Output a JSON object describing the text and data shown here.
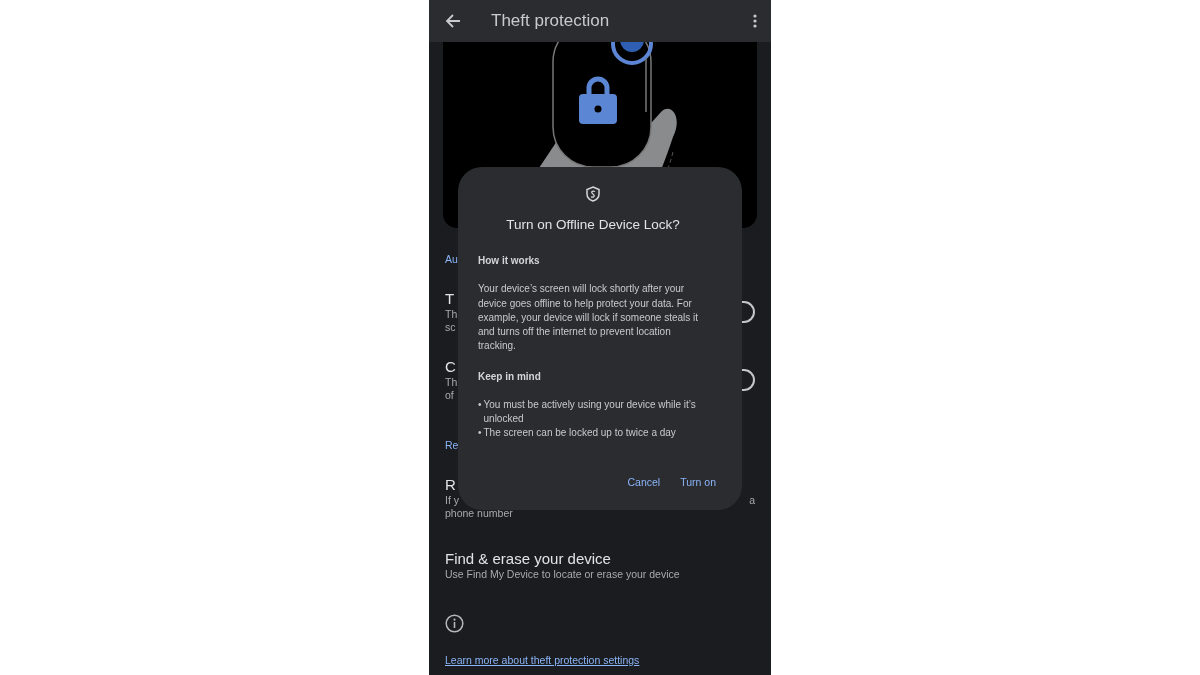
{
  "app_bar": {
    "title": "Theft protection"
  },
  "behind_dialog": {
    "section_link_1": "Au",
    "items": [
      {
        "title": "T",
        "subtitle_lines": [
          "Th",
          "sc"
        ],
        "toggle": {
          "on": false
        }
      },
      {
        "title": "C",
        "subtitle_lines": [
          "Th",
          "of"
        ],
        "toggle": {
          "on": false
        }
      }
    ],
    "section_link_2": "Re",
    "remote_item": {
      "title": "R",
      "subtitle_start": "If y",
      "subtitle_end": "a",
      "subtitle_line_2": "phone number"
    }
  },
  "find_item": {
    "title": "Find & erase your device",
    "subtitle": "Use Find My Device to locate or erase your device"
  },
  "learn_more_link": "Learn more about theft protection settings",
  "dialog": {
    "title": "Turn on Offline Device Lock?",
    "sections": [
      {
        "heading": "How it works",
        "kind": "paragraph",
        "text": "Your device’s screen will lock shortly after your device goes offline to help protect your data. For example, your device will lock if someone steals it and turns off the internet to prevent location tracking."
      },
      {
        "heading": "Keep in mind",
        "kind": "bullets",
        "bullet": "•",
        "items": [
          "You must be actively using your device while it’s unlocked",
          "The screen can be locked up to twice a day"
        ]
      }
    ],
    "buttons": [
      "Cancel",
      "Turn on"
    ]
  }
}
